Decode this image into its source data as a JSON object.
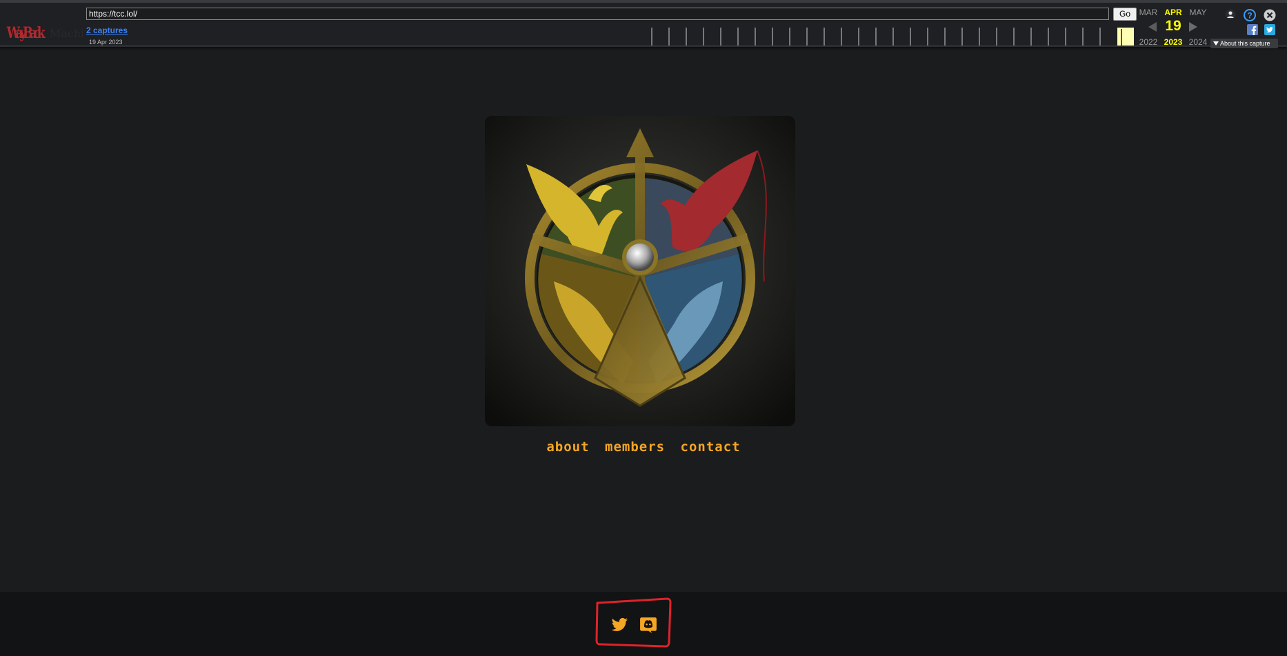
{
  "wayback": {
    "logo_alt": "Wayback Machine",
    "url": "https://tcc.lol/",
    "go_label": "Go",
    "captures_label": "2 captures",
    "capture_date": "19 Apr 2023",
    "calendar": {
      "prev_month": "MAR",
      "current_month": "APR",
      "next_month": "MAY",
      "day": "19",
      "prev_year": "2022",
      "current_year": "2023",
      "next_year": "2024"
    },
    "about_label": "About this capture",
    "colors": {
      "current": "#ffff00",
      "muted": "#9a9a9a"
    }
  },
  "site": {
    "emblem_alt": "Crest with four birds",
    "nav": [
      {
        "label": "about"
      },
      {
        "label": "members"
      },
      {
        "label": "contact"
      }
    ],
    "social": [
      {
        "icon": "twitter-icon"
      },
      {
        "icon": "discord-icon"
      }
    ],
    "accent_color": "#f5a623"
  }
}
